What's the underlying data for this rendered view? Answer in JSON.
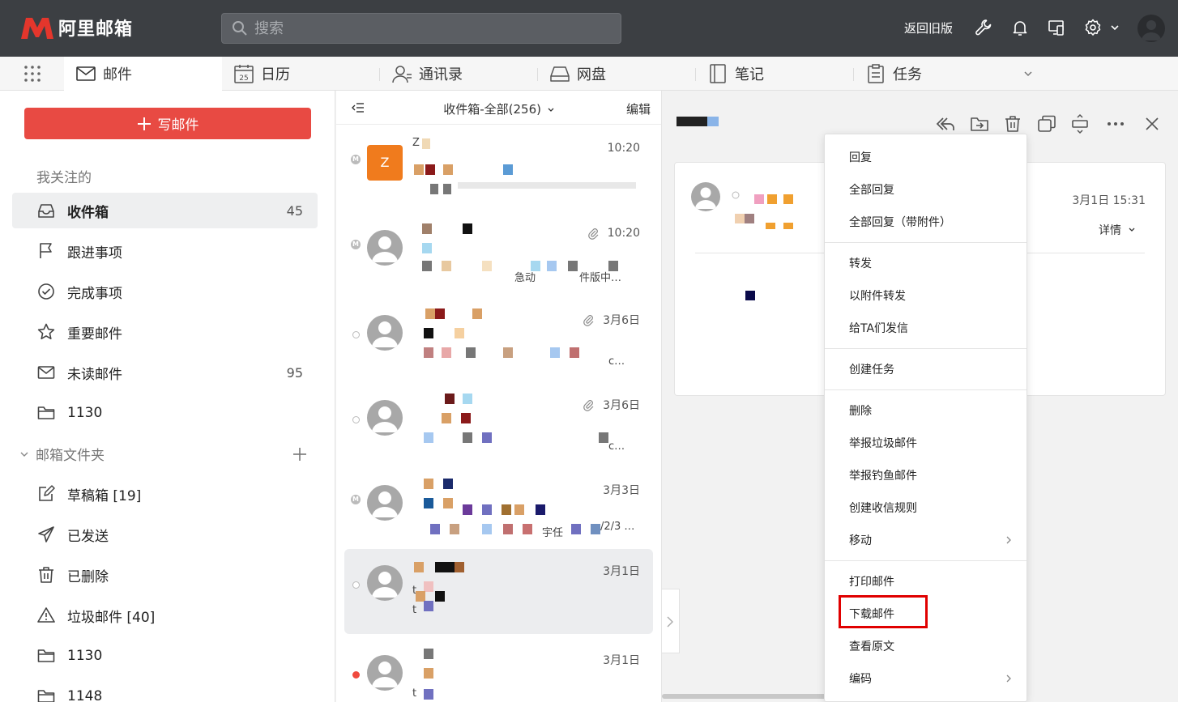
{
  "app": {
    "logo_text": "阿里邮箱",
    "search_placeholder": "搜索",
    "old_version": "返回旧版"
  },
  "header_icons": [
    "wrench-icon",
    "bell-icon",
    "devices-icon",
    "gear-icon",
    "chevron-down-icon",
    "user-avatar"
  ],
  "tabs": [
    {
      "label": "邮件",
      "icon": "envelope-icon",
      "active": true
    },
    {
      "label": "日历",
      "icon": "calendar-icon",
      "calendar_day": "25"
    },
    {
      "label": "通讯录",
      "icon": "contacts-icon"
    },
    {
      "label": "网盘",
      "icon": "drive-icon"
    },
    {
      "label": "笔记",
      "icon": "notebook-icon"
    },
    {
      "label": "任务",
      "icon": "clipboard-icon"
    }
  ],
  "sidebar": {
    "compose_label": "写邮件",
    "favorites_title": "我关注的",
    "favorites": [
      {
        "label": "收件箱",
        "icon": "inbox-icon",
        "count": "45",
        "active": true
      },
      {
        "label": "跟进事项",
        "icon": "flag-icon",
        "count": ""
      },
      {
        "label": "完成事项",
        "icon": "check-circle-icon",
        "count": ""
      },
      {
        "label": "重要邮件",
        "icon": "star-icon",
        "count": ""
      },
      {
        "label": "未读邮件",
        "icon": "envelope-icon",
        "count": "95"
      },
      {
        "label": "1130",
        "icon": "folder-icon",
        "count": ""
      }
    ],
    "folders_title": "邮箱文件夹",
    "folders": [
      {
        "label": "草稿箱 [19]",
        "icon": "draft-icon"
      },
      {
        "label": "已发送",
        "icon": "send-icon"
      },
      {
        "label": "已删除",
        "icon": "trash-icon"
      },
      {
        "label": "垃圾邮件 [40]",
        "icon": "warning-icon"
      },
      {
        "label": "1130",
        "icon": "folder-icon"
      },
      {
        "label": "1148",
        "icon": "folder-icon"
      }
    ]
  },
  "maillist": {
    "title": "收件箱-全部(256)",
    "edit_label": "编辑",
    "mails": [
      {
        "time": "10:20",
        "attachment": false,
        "avatar_letter": "Z",
        "dot": "m"
      },
      {
        "time": "10:20",
        "attachment": true,
        "avatar_letter": "",
        "dot": "m"
      },
      {
        "time": "3月6日",
        "attachment": true,
        "avatar_letter": "",
        "dot": "empty"
      },
      {
        "time": "3月6日",
        "attachment": true,
        "avatar_letter": "",
        "dot": "empty"
      },
      {
        "time": "3月3日",
        "attachment": false,
        "avatar_letter": "",
        "dot": "m"
      },
      {
        "time": "3月1日",
        "attachment": false,
        "avatar_letter": "",
        "dot": "empty",
        "selected": true
      },
      {
        "time": "3月1日",
        "attachment": false,
        "avatar_letter": "",
        "dot": "unread"
      }
    ],
    "fragments": {
      "m0_line1": "Z",
      "m1_line3": "急动",
      "m1_line3b": "件版中…",
      "m2_ellipsis": "c…",
      "m3_ellipsis": "c…",
      "m4_line3": "/2/3 …",
      "m4_mid": "宇任",
      "m5_t1": "t",
      "m5_t2": "t",
      "m6_t1": "t"
    }
  },
  "reader": {
    "date": "3月1日 15:31",
    "detail_label": "详情",
    "toolbar_icons": [
      "reply-all-icon",
      "move-to-folder-icon",
      "trash-icon",
      "new-window-icon",
      "expand-icon",
      "more-icon",
      "close-icon"
    ]
  },
  "context_menu": {
    "items": [
      {
        "label": "回复",
        "group": 1
      },
      {
        "label": "全部回复",
        "group": 1
      },
      {
        "label": "全部回复（带附件）",
        "group": 1
      },
      {
        "label": "转发",
        "group": 2
      },
      {
        "label": "以附件转发",
        "group": 2
      },
      {
        "label": "给TA们发信",
        "group": 2
      },
      {
        "label": "创建任务",
        "group": 3
      },
      {
        "label": "删除",
        "group": 4
      },
      {
        "label": "举报垃圾邮件",
        "group": 4
      },
      {
        "label": "举报钓鱼邮件",
        "group": 4
      },
      {
        "label": "创建收信规则",
        "group": 4
      },
      {
        "label": "移动",
        "group": 4,
        "submenu": true
      },
      {
        "label": "打印邮件",
        "group": 5
      },
      {
        "label": "下载邮件",
        "group": 5,
        "highlighted": true
      },
      {
        "label": "查看原文",
        "group": 5
      },
      {
        "label": "编码",
        "group": 5,
        "submenu": true
      }
    ]
  },
  "colors": {
    "header_bg": "#3c3f43",
    "compose_red": "#e84a43",
    "highlight_red": "#e00000",
    "unread_dot": "#f04a3f",
    "avatar_orange": "#f07b1d"
  }
}
